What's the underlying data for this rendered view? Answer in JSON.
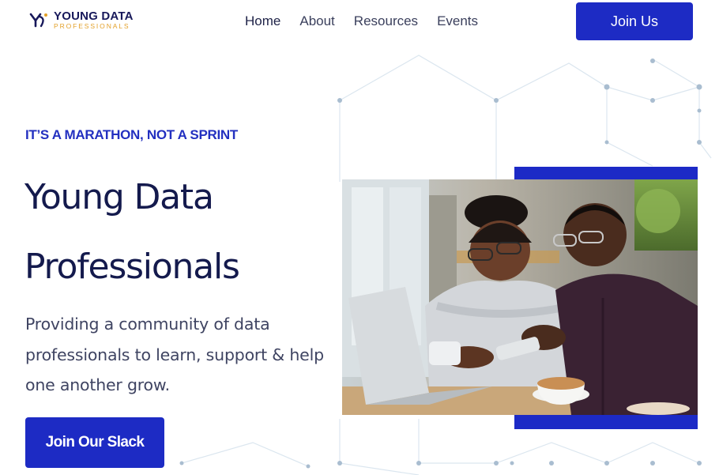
{
  "header": {
    "logo": {
      "title": "YOUNG DATA",
      "subtitle": "PROFESSIONALS",
      "icon": "yd-logo-mark-icon"
    },
    "nav": [
      {
        "label": "Home"
      },
      {
        "label": "About"
      },
      {
        "label": "Resources"
      },
      {
        "label": "Events"
      }
    ],
    "cta_label": "Join Us"
  },
  "hero": {
    "eyebrow": "IT’S A MARATHON, NOT A SPRINT",
    "title_line1": "Young Data",
    "title_line2": "Professionals",
    "description": "Providing a community of data professionals to learn, support & help one another grow.",
    "cta_label": "Join Our Slack",
    "image_alt": "Two young professionals smiling while looking at phones beside a laptop in a café"
  },
  "colors": {
    "brand_blue": "#1d2bc4",
    "navy_text": "#141a4d",
    "logo_accent": "#e3a12a",
    "background": "#ffffff"
  }
}
